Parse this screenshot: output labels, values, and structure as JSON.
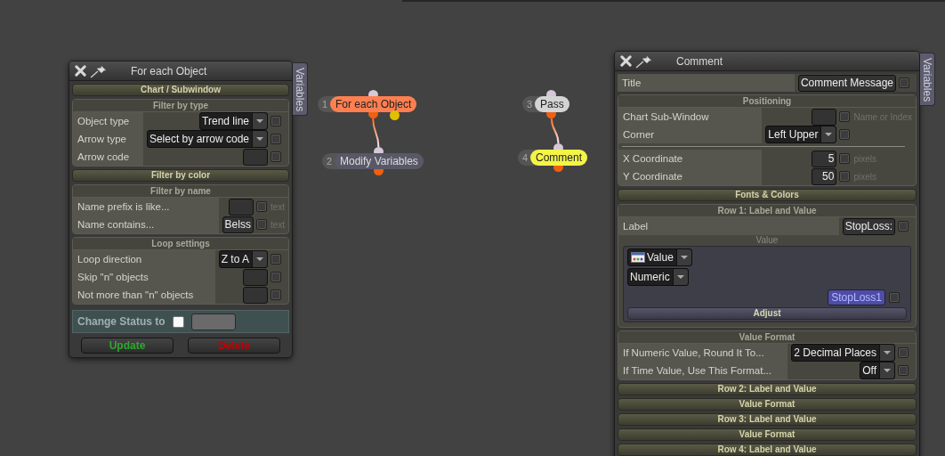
{
  "panels": [
    {
      "title": "For each Object",
      "side_tab": "Variables",
      "sections": [
        {
          "kind": "header",
          "title": "Chart / Subwindow"
        },
        {
          "kind": "group",
          "title": "Filter by type",
          "rows": [
            {
              "kind": "select",
              "label": "Object type",
              "value": "Trend line",
              "checked": false
            },
            {
              "kind": "select",
              "label": "Arrow type",
              "value": "Select by arrow code",
              "checked": false
            },
            {
              "kind": "input",
              "label": "Arrow code",
              "checked": false
            }
          ]
        },
        {
          "kind": "header",
          "title": "Filter by color"
        },
        {
          "kind": "group",
          "title": "Filter by name",
          "rows": [
            {
              "kind": "input",
              "label": "Name prefix is like...",
              "checked": false,
              "hint": "text"
            },
            {
              "kind": "input",
              "label": "Name contains...",
              "value": "Belss",
              "checked": false,
              "hint": "text"
            }
          ]
        },
        {
          "kind": "group",
          "title": "Loop settings",
          "rows": [
            {
              "kind": "select",
              "label": "Loop direction",
              "value": "Z to A",
              "checked": false
            },
            {
              "kind": "input",
              "label": "Skip \"n\" objects",
              "checked": false
            },
            {
              "kind": "input",
              "label": "Not more than \"n\" objects",
              "checked": false
            }
          ]
        },
        {
          "kind": "status",
          "label": "Change Status to",
          "checked": false
        },
        {
          "kind": "buttons",
          "buttons": [
            {
              "label": "Update",
              "color": "#2ea82e"
            },
            {
              "label": "Delete",
              "color": "#c40000"
            }
          ]
        }
      ]
    },
    {
      "title": "Comment",
      "side_tab": "Variables",
      "sections": [
        {
          "kind": "fields",
          "rows": [
            {
              "kind": "input",
              "label": "Title",
              "value": "Comment Message",
              "checked": false
            }
          ]
        },
        {
          "kind": "group",
          "title": "Positioning",
          "rows": [
            {
              "kind": "input",
              "label": "Chart Sub-Window",
              "checked": false,
              "hint": "Name or Index"
            },
            {
              "kind": "select",
              "label": "Corner",
              "value": "Left Upper",
              "checked": false
            },
            {
              "kind": "separator"
            },
            {
              "kind": "input",
              "label": "X Coordinate",
              "value": "5",
              "checked": false,
              "hint": "pixels"
            },
            {
              "kind": "input",
              "label": "Y Coordinate",
              "value": "50",
              "checked": false,
              "hint": "pixels"
            }
          ]
        },
        {
          "kind": "header",
          "title": "Fonts & Colors"
        },
        {
          "kind": "group",
          "title": "Row 1: Label and Value",
          "rows": [
            {
              "kind": "input",
              "label": "Label",
              "value": "StopLoss:",
              "checked": false
            }
          ],
          "value_box": {
            "title": "Value",
            "selects": [
              {
                "kind": "icon-select",
                "value": "Value"
              },
              {
                "kind": "select",
                "value": "Numeric"
              }
            ],
            "variable": {
              "value": "StopLoss1",
              "checked": false
            },
            "button": "Adjust"
          }
        },
        {
          "kind": "group",
          "title": "Value Format",
          "rows": [
            {
              "kind": "select",
              "label": "If Numeric Value, Round It To...",
              "value": "2 Decimal Places",
              "checked": false
            },
            {
              "kind": "select",
              "label": "If Time Value, Use This Format...",
              "value": "Off",
              "checked": false
            }
          ]
        },
        {
          "kind": "header",
          "title": "Row 2: Label and Value"
        },
        {
          "kind": "header",
          "title": "Value Format"
        },
        {
          "kind": "header",
          "title": "Row 3: Label and Value"
        },
        {
          "kind": "header",
          "title": "Value Format"
        },
        {
          "kind": "header",
          "title": "Row 4: Label and Value"
        }
      ]
    }
  ],
  "nodes": [
    {
      "number": "1",
      "label": "For each Object",
      "color": "#ff7f50",
      "branch_port": true
    },
    {
      "number": "2",
      "label": "Modify Variables",
      "color": "#585868",
      "branch_port": false
    },
    {
      "number": "3",
      "label": "Pass",
      "color": "#d4d4d4",
      "branch_port": false
    },
    {
      "number": "4",
      "label": "Comment",
      "color": "#f4f446",
      "branch_port": false
    }
  ]
}
